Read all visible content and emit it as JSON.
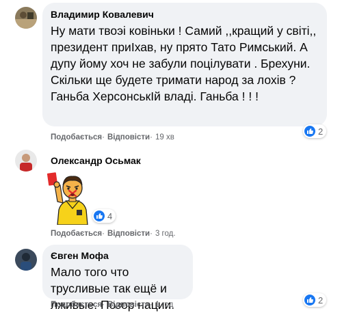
{
  "comments": [
    {
      "author": "Владимир Ковалевич",
      "text": "Ну мати твоэі ковіньки ! Самий ,,кращий у світі,, президент приІхав, ну прято Тато Римський. А дупу йому хоч не забули поцілувати . Брехуни. Скільки ще будете тримати народ за лохів ? Ганьба ХерсонськІй владі. Ганьба ! ! !",
      "like_label": "Подобається",
      "reply_label": "Відповісти",
      "time": "19 хв",
      "reaction_count": "2"
    },
    {
      "author": "Олександр Осьмак",
      "like_label": "Подобається",
      "reply_label": "Відповісти",
      "time": "3 год.",
      "reaction_count": "4"
    },
    {
      "author": "Євген Мофа",
      "text": "Мало того что трусливые так ещё и лживые. Позор нации.",
      "like_label": "Подобається",
      "reply_label": "Відповісти",
      "time": "1 год",
      "reaction_count": "2"
    }
  ],
  "colors": {
    "bubble": "#f0f2f5",
    "like_blue": "#1877f2",
    "muted": "#65676b"
  }
}
